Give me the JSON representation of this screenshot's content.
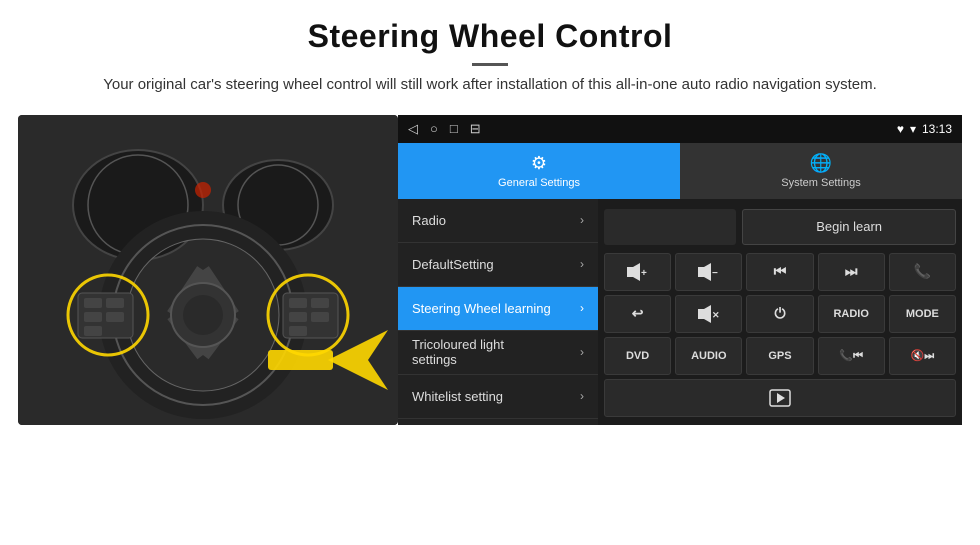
{
  "header": {
    "title": "Steering Wheel Control",
    "subtitle": "Your original car's steering wheel control will still work after installation of this all-in-one auto radio navigation system.",
    "divider": true
  },
  "tabs": [
    {
      "id": "general",
      "label": "General Settings",
      "icon": "⚙",
      "active": true
    },
    {
      "id": "system",
      "label": "System Settings",
      "icon": "🌐",
      "active": false
    }
  ],
  "statusBar": {
    "icons": [
      "◁",
      "○",
      "□",
      "⊟"
    ],
    "right": "♥ ▾ 13:13"
  },
  "menu": [
    {
      "id": "radio",
      "label": "Radio",
      "selected": false
    },
    {
      "id": "default",
      "label": "DefaultSetting",
      "selected": false
    },
    {
      "id": "steering",
      "label": "Steering Wheel learning",
      "selected": true
    },
    {
      "id": "tricoloured",
      "label": "Tricoloured light settings",
      "selected": false
    },
    {
      "id": "whitelist",
      "label": "Whitelist setting",
      "selected": false
    }
  ],
  "controls": {
    "beginLearnLabel": "Begin learn",
    "row1": [
      "🔊+",
      "🔊−",
      "⏮",
      "⏭",
      "📞"
    ],
    "row2": [
      "📞↩",
      "🔇",
      "⏻",
      "RADIO",
      "MODE"
    ],
    "row3": [
      "DVD",
      "AUDIO",
      "GPS",
      "📞⏮",
      "🔇⏭"
    ],
    "lastRow": [
      "🎬"
    ]
  }
}
